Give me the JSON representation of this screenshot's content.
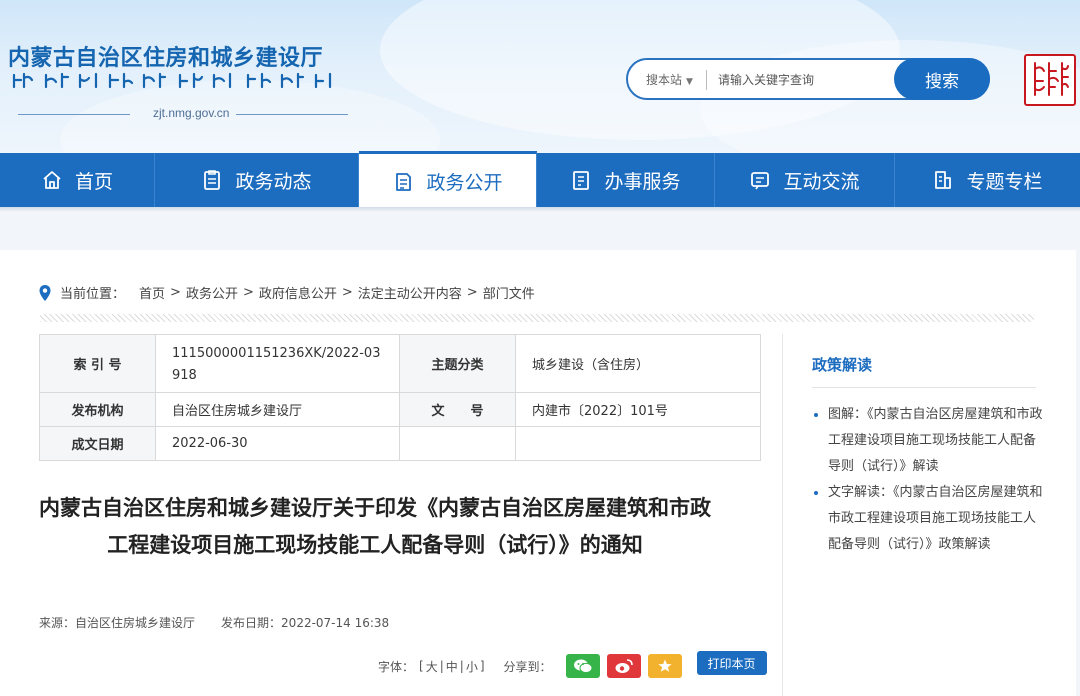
{
  "header": {
    "site_title": "内蒙古自治区住房和城乡建设厅",
    "domain": "zjt.nmg.gov.cn",
    "search": {
      "scope": "搜本站",
      "placeholder": "请输入关键字查询",
      "button": "搜索"
    },
    "seal_icon": "mongolian-script-seal-icon"
  },
  "nav": {
    "items": [
      {
        "label": "首页",
        "icon": "home-icon"
      },
      {
        "label": "政务动态",
        "icon": "document-icon"
      },
      {
        "label": "政务公开",
        "icon": "file-list-icon",
        "active": true
      },
      {
        "label": "办事服务",
        "icon": "clipboard-icon"
      },
      {
        "label": "互动交流",
        "icon": "chat-icon"
      },
      {
        "label": "专题专栏",
        "icon": "column-icon"
      }
    ]
  },
  "breadcrumb": {
    "lead": "当前位置：",
    "items": [
      "首页",
      "政务公开",
      "政府信息公开",
      "法定主动公开内容",
      "部门文件"
    ]
  },
  "meta": {
    "index_label": "索 引 号",
    "index_value": "1115000001151236XK/2022-03918",
    "category_label": "主题分类",
    "category_value": "城乡建设（含住房）",
    "publisher_label": "发布机构",
    "publisher_value": "自治区住房城乡建设厅",
    "docno_label": "文　　号",
    "docno_value": "内建市〔2022〕101号",
    "date_label": "成文日期",
    "date_value": "2022-06-30"
  },
  "article": {
    "title": "内蒙古自治区住房和城乡建设厅关于印发《内蒙古自治区房屋建筑和市政工程建设项目施工现场技能工人配备导则（试行）》的通知",
    "source_label": "来源：",
    "source_value": "自治区住房城乡建设厅",
    "pubdate_label": "发布日期：",
    "pubdate_value": "2022-07-14 16:38"
  },
  "tools": {
    "font_label": "字体：",
    "bracket_open": "[",
    "size_large": "大",
    "divider": "|",
    "size_medium": "中",
    "size_small": "小",
    "bracket_close": "]",
    "share_label": "分享到：",
    "print": "打印本页",
    "share_colors": {
      "wechat": "#36b44a",
      "weibo": "#e0373b",
      "favorite": "#f2b22e"
    }
  },
  "sidebar": {
    "title": "政策解读",
    "items": [
      "图解：《内蒙古自治区房屋建筑和市政工程建设项目施工现场技能工人配备导则（试行）》解读",
      "文字解读：《内蒙古自治区房屋建筑和市政工程建设项目施工现场技能工人配备导则（试行）》政策解读"
    ]
  },
  "colors": {
    "brand_blue": "#1c6cbf",
    "seal_red": "#c8171e"
  }
}
